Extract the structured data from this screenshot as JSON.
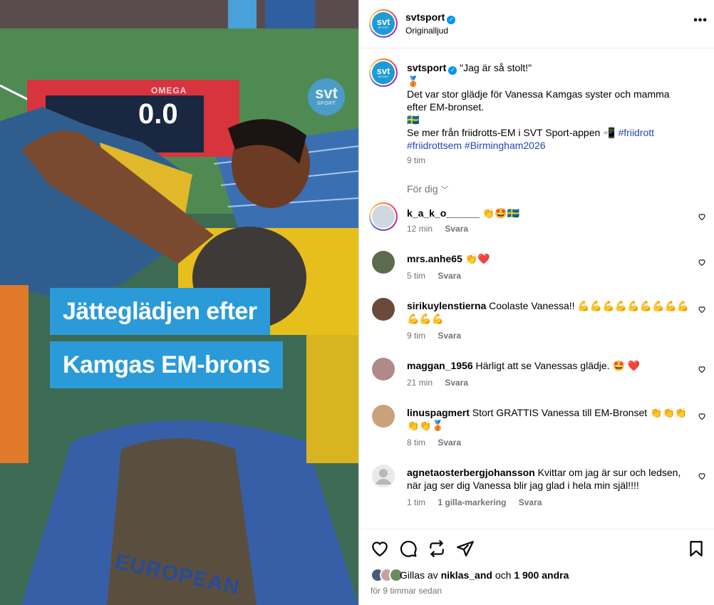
{
  "video": {
    "caption_line1": "Jätteglädjen efter",
    "caption_line2": "Kamgas EM-brons",
    "logo_text": "svt",
    "logo_sub": "SPORT",
    "scoreboard_brand": "OMEGA",
    "scoreboard_value": "0.0",
    "vest_text": "EUROPEAN"
  },
  "header": {
    "username": "svtsport",
    "audio_label": "Originalljud",
    "more_label": "•••"
  },
  "caption": {
    "username": "svtsport",
    "quote": "\"Jag är så stolt!\"",
    "line1": "🥉",
    "line2": "Det var stor glädje för Vanessa Kamgas syster och mamma efter EM-bronset.",
    "line3": "🇸🇪",
    "line4": "Se mer från friidrotts-EM i SVT Sport-appen 📲",
    "hashtag1": "#friidrott",
    "hashtag2": "#friidrottsem",
    "hashtag3": "#Birmingham2026",
    "time": "9 tim",
    "sort_label": "För dig"
  },
  "comments": [
    {
      "user": "k_a_k_o______",
      "text": "👏🤩🇸🇪",
      "time": "12 min",
      "reply": "Svara",
      "likes": ""
    },
    {
      "user": "mrs.anhe65",
      "text": "👏❤️",
      "time": "5 tim",
      "reply": "Svara",
      "likes": ""
    },
    {
      "user": "sirikuylenstierna",
      "text": "Coolaste Vanessa!! 💪💪💪💪💪💪💪💪💪💪💪💪",
      "time": "9 tim",
      "reply": "Svara",
      "likes": ""
    },
    {
      "user": "maggan_1956",
      "text": "Härligt att se Vanessas glädje. 🤩 ❤️",
      "time": "21 min",
      "reply": "Svara",
      "likes": ""
    },
    {
      "user": "linuspagmert",
      "text": "Stort GRATTIS Vanessa till EM-Bronset 👏👏👏👏👏🥉",
      "time": "8 tim",
      "reply": "Svara",
      "likes": ""
    },
    {
      "user": "agnetaosterbergjohansson",
      "text": "Kvittar om jag är sur och ledsen, när jag ser dig Vanessa blir jag glad i hela min själ!!!!",
      "time": "1 tim",
      "reply": "Svara",
      "likes": "1 gilla-markering"
    }
  ],
  "footer": {
    "liked_prefix": "Gillas av",
    "liked_user": "niklas_and",
    "liked_and": "och",
    "liked_count": "1 900 andra",
    "date": "för 9 timmar sedan"
  },
  "colors": {
    "accent_blue": "#0095f6",
    "caption_bg": "#2a9bd8",
    "hashtag": "#2547b4",
    "muted": "#737373"
  }
}
